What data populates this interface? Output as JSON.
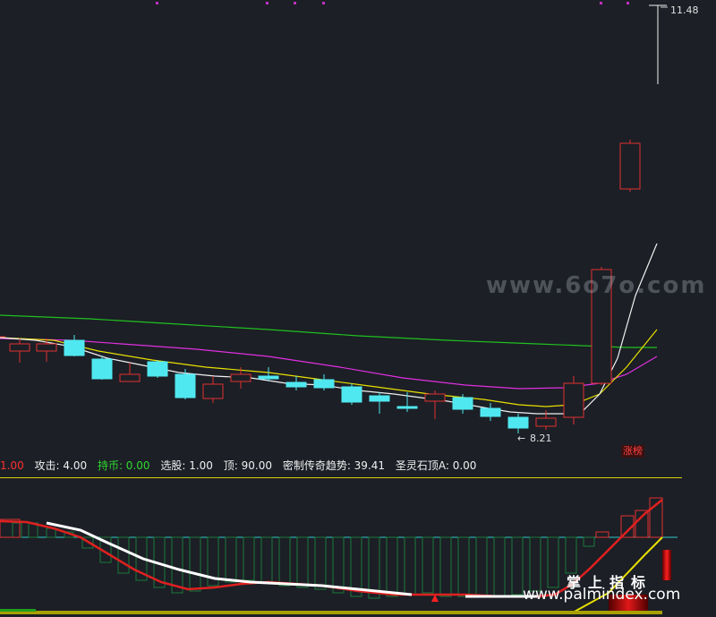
{
  "main_chart": {
    "high_label": "11.48",
    "low_label": "8.21",
    "limit_up_badge": "涨榜"
  },
  "indicator_bar": {
    "items": [
      {
        "text": "1.00",
        "color": "#ff3030"
      },
      {
        "text": "攻击: 4.00",
        "color": "#f0f0f0"
      },
      {
        "text": "持币: 0.00",
        "color": "#30d830"
      },
      {
        "text": "选股: 1.00",
        "color": "#f0f0f0"
      },
      {
        "text": "顶: 90.00",
        "color": "#f0f0f0"
      },
      {
        "text": "密制传奇趋势: 39.41",
        "color": "#f0f0f0"
      },
      {
        "text": "圣灵石顶A: 0.00",
        "color": "#f0f0f0"
      }
    ]
  },
  "watermarks": {
    "site_6o7o": "www.6o7o.com",
    "palm_cn": "掌上指标",
    "palm_url": "www.palmindex.com"
  },
  "colors": {
    "background": "#1c1f26",
    "up_candle": "#e03030",
    "down_candle": "#50e8f0",
    "ma_white": "#f0f0f0",
    "ma_yellow": "#e8e000",
    "ma_magenta": "#e030e0",
    "ma_green": "#20c020"
  }
}
